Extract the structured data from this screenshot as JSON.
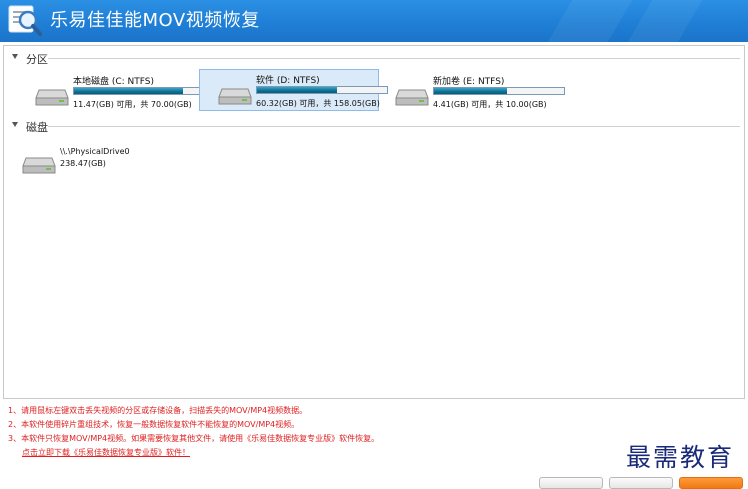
{
  "window": {
    "title": "乐易佳佳能MOV视频恢复"
  },
  "partition_group": {
    "label": "分区"
  },
  "disk_group": {
    "label": "磁盘"
  },
  "partitions": [
    {
      "name": "本地磁盘 (C: NTFS)",
      "size_text": "11.47(GB) 可用，共 70.00(GB)",
      "used_fraction": 0.836
    },
    {
      "name": "软件 (D: NTFS)",
      "size_text": "60.32(GB) 可用，共 158.05(GB)",
      "used_fraction": 0.618
    },
    {
      "name": "新加卷 (E: NTFS)",
      "size_text": "4.41(GB) 可用，共 10.00(GB)",
      "used_fraction": 0.559
    }
  ],
  "disks": [
    {
      "name": "\\\\.\\PhysicalDrive0",
      "size_text": "238.47(GB)"
    }
  ],
  "notes": {
    "line1": "1、请用鼠标左键双击丢失视频的分区或存储设备，扫描丢失的MOV/MP4视频数据。",
    "line2": "2、本软件使用碎片重组技术，恢复一般数据恢复软件不能恢复的MOV/MP4视频。",
    "line3": "3、本软件只恢复MOV/MP4视频。如果需要恢复其他文件，请使用《乐易佳数据恢复专业版》软件恢复。",
    "link": "点击立即下载《乐易佳数据恢复专业版》软件！"
  },
  "watermark": "最需教育",
  "colors": {
    "titlebar": "#1f7fd6",
    "selection": "#dbeaf8",
    "bar_fill": "#0e6f93",
    "note_red": "#e02020",
    "primary_button": "#f07a12"
  }
}
